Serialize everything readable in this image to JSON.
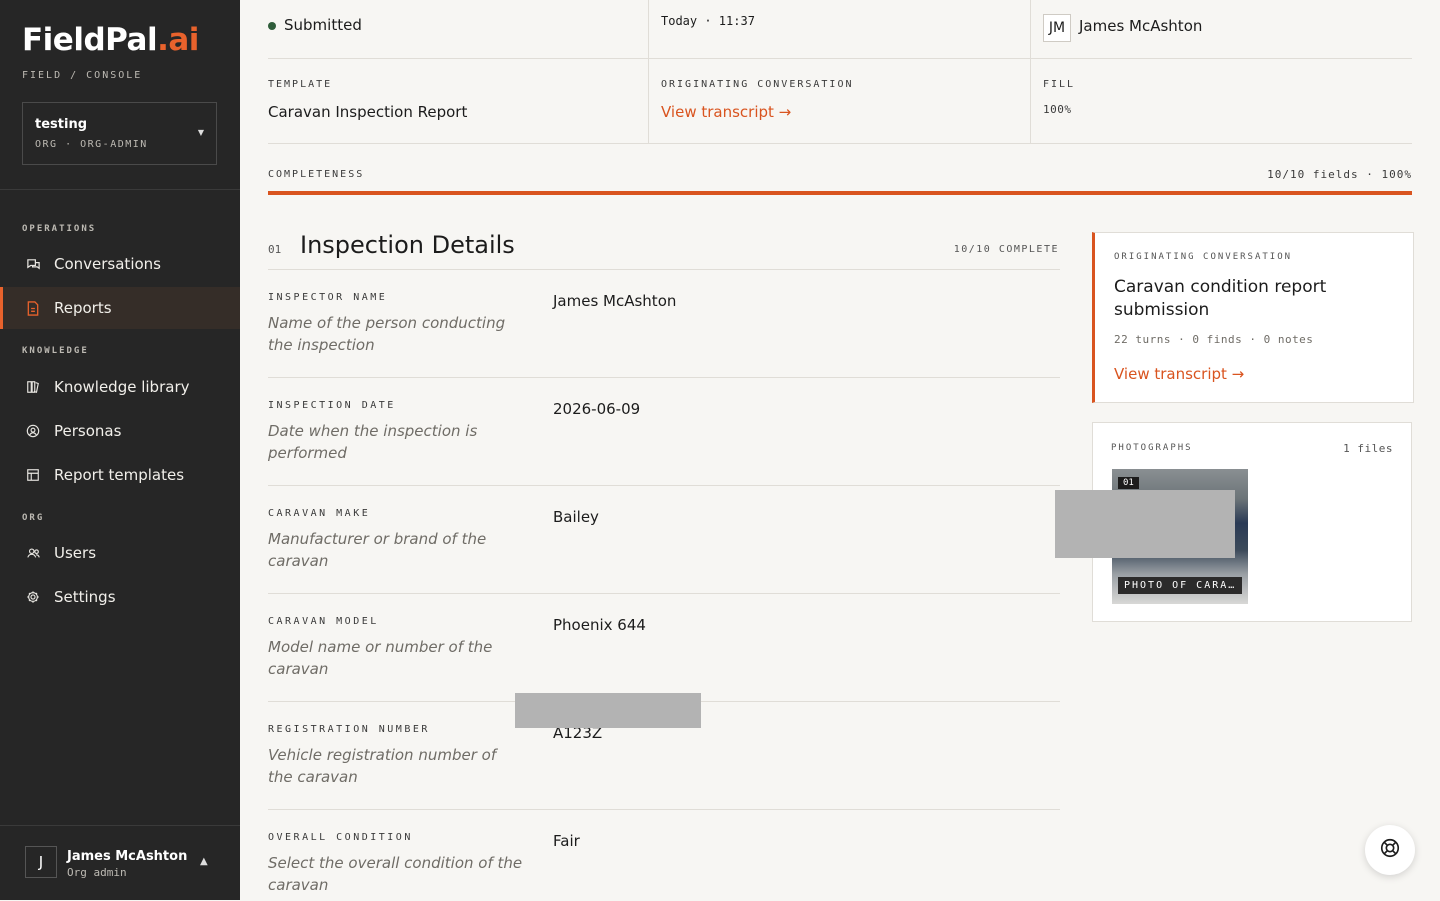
{
  "brand": {
    "name_main": "FieldPal",
    "name_accent": ".ai",
    "subtitle": "FIELD / CONSOLE"
  },
  "org": {
    "name": "testing",
    "role": "ORG · ORG-ADMIN"
  },
  "nav": {
    "sections": {
      "operations": "OPERATIONS",
      "knowledge": "KNOWLEDGE",
      "org": "ORG"
    },
    "items": [
      {
        "label": "Conversations",
        "icon": "chat-icon"
      },
      {
        "label": "Reports",
        "icon": "document-icon",
        "active": true
      },
      {
        "label": "Knowledge library",
        "icon": "books-icon"
      },
      {
        "label": "Personas",
        "icon": "persona-icon"
      },
      {
        "label": "Report templates",
        "icon": "template-icon"
      },
      {
        "label": "Users",
        "icon": "users-icon"
      },
      {
        "label": "Settings",
        "icon": "gear-icon"
      }
    ]
  },
  "user": {
    "initial": "J",
    "name": "James McAshton",
    "role": "Org admin"
  },
  "summary": {
    "status": "Submitted",
    "filed": "Today · 11:37",
    "inspector_initials": "JM",
    "inspector_name": "James McAshton",
    "template_label": "TEMPLATE",
    "template_value": "Caravan Inspection Report",
    "originating_label": "ORIGINATING CONVERSATION",
    "originating_link": "View transcript →",
    "fill_label": "FILL",
    "fill_value": "100%"
  },
  "completeness": {
    "label": "COMPLETENESS",
    "value": "10/10 fields · 100%",
    "fraction": 1.0
  },
  "section": {
    "number": "01",
    "title": "Inspection Details",
    "status": "10/10 COMPLETE",
    "fields": [
      {
        "label": "INSPECTOR NAME",
        "description": "Name of the person conducting the inspection",
        "value": "James McAshton"
      },
      {
        "label": "INSPECTION DATE",
        "description": "Date when the inspection is performed",
        "value": "2026-06-09"
      },
      {
        "label": "CARAVAN MAKE",
        "description": "Manufacturer or brand of the caravan",
        "value": "Bailey"
      },
      {
        "label": "CARAVAN MODEL",
        "description": "Model name or number of the caravan",
        "value": "Phoenix 644"
      },
      {
        "label": "REGISTRATION NUMBER",
        "description": "Vehicle registration number of the caravan",
        "value": "A123Z"
      },
      {
        "label": "OVERALL CONDITION",
        "description": "Select the overall condition of the caravan",
        "value": "Fair"
      }
    ]
  },
  "conversation_card": {
    "label": "ORIGINATING CONVERSATION",
    "title": "Caravan condition report submission",
    "meta": "22 turns · 0 finds · 0 notes",
    "link": "View transcript →"
  },
  "photos": {
    "label": "PHOTOGRAPHS",
    "count": "1 files",
    "items": [
      {
        "number": "01",
        "caption": "PHOTO OF CARA…"
      }
    ]
  },
  "colors": {
    "accent": "#d9541f",
    "sidebar_bg": "#262626",
    "page_bg": "#f7f6f3",
    "status_ok": "#2f5d3a"
  }
}
